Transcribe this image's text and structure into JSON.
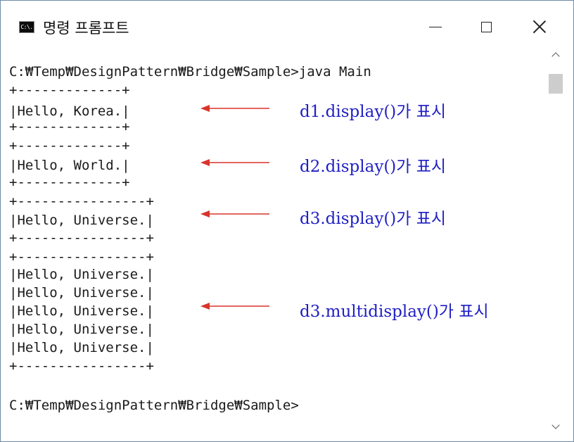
{
  "window": {
    "title": "명령 프롬프트",
    "icon_name": "cmd-icon",
    "icon_text": "C:\\.",
    "controls": [
      "minimize-icon",
      "maximize-icon",
      "close-icon"
    ]
  },
  "console": {
    "lines": [
      "C:₩Temp₩DesignPattern₩Bridge₩Sample>java Main",
      "+-------------+",
      "|Hello, Korea.|",
      "+-------------+",
      "+-------------+",
      "|Hello, World.|",
      "+-------------+",
      "+----------------+",
      "|Hello, Universe.|",
      "+----------------+",
      "+----------------+",
      "|Hello, Universe.|",
      "|Hello, Universe.|",
      "|Hello, Universe.|",
      "|Hello, Universe.|",
      "|Hello, Universe.|",
      "+----------------+",
      "C:₩Temp₩DesignPattern₩Bridge₩Sample>"
    ]
  },
  "annotations": [
    {
      "label": "d1.display()가 표시",
      "arrow_icon": "left-arrow-icon"
    },
    {
      "label": "d2.display()가 표시",
      "arrow_icon": "left-arrow-icon"
    },
    {
      "label": "d3.display()가 표시",
      "arrow_icon": "left-arrow-icon"
    },
    {
      "label": "d3.multidisplay()가 표시",
      "arrow_icon": "left-arrow-icon"
    }
  ],
  "colors": {
    "console_text": "#1a1a1a",
    "annotation_text": "#1f1fc4",
    "arrow": "#d9342b",
    "scroll_thumb": "#cdcdcd"
  }
}
